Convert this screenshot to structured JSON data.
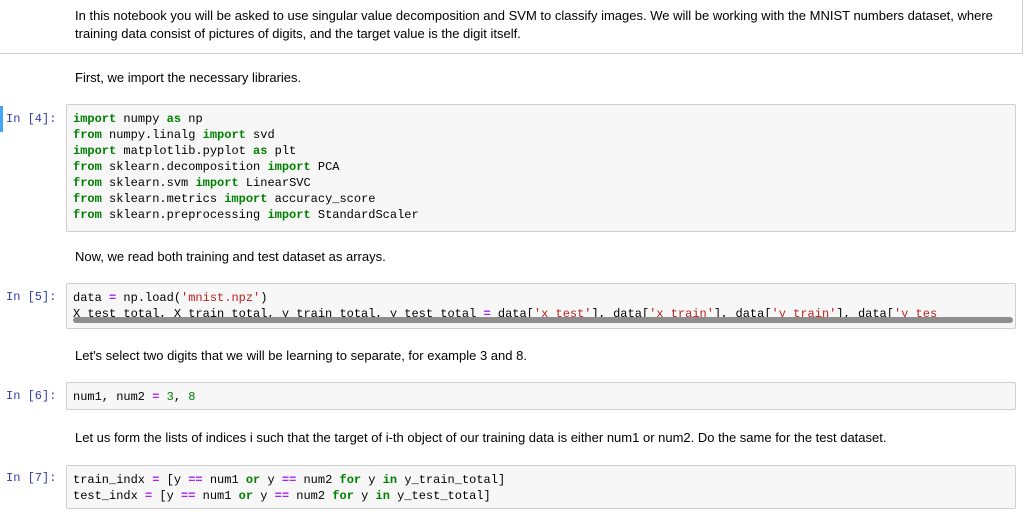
{
  "intro": "In this notebook you will be asked to use singular value decomposition and SVM to classify images. We will be working with the MNIST numbers dataset, where training data consist of pictures of digits, and the target value is the digit itself.",
  "md1": "First, we import the necessary libraries.",
  "md2": "Now, we read both training and test dataset as arrays.",
  "md3": "Let's select two digits that we will be learning to separate, for example 3 and 8.",
  "md4": "Let us form the lists of indices i such that the target of i-th object of our training data is either num1 or num2. Do the same for the test dataset.",
  "cells": [
    {
      "prompt": "In [4]:",
      "lines": [
        [
          [
            "kw",
            "import"
          ],
          [
            "t",
            " numpy "
          ],
          [
            "kw",
            "as"
          ],
          [
            "t",
            " np"
          ]
        ],
        [
          [
            "kw",
            "from"
          ],
          [
            "t",
            " numpy.linalg "
          ],
          [
            "kw",
            "import"
          ],
          [
            "t",
            " svd"
          ]
        ],
        [
          [
            "kw",
            "import"
          ],
          [
            "t",
            " matplotlib.pyplot "
          ],
          [
            "kw",
            "as"
          ],
          [
            "t",
            " plt"
          ]
        ],
        [
          [
            "kw",
            "from"
          ],
          [
            "t",
            " sklearn.decomposition "
          ],
          [
            "kw",
            "import"
          ],
          [
            "t",
            " PCA"
          ]
        ],
        [
          [
            "kw",
            "from"
          ],
          [
            "t",
            " sklearn.svm "
          ],
          [
            "kw",
            "import"
          ],
          [
            "t",
            " LinearSVC"
          ]
        ],
        [
          [
            "kw",
            "from"
          ],
          [
            "t",
            " sklearn.metrics "
          ],
          [
            "kw",
            "import"
          ],
          [
            "t",
            " accuracy_score"
          ]
        ],
        [
          [
            "kw",
            "from"
          ],
          [
            "t",
            " sklearn.preprocessing "
          ],
          [
            "kw",
            "import"
          ],
          [
            "t",
            " StandardScaler"
          ]
        ]
      ]
    },
    {
      "prompt": "In [5]:",
      "lines": [
        [
          [
            "t",
            "data "
          ],
          [
            "op",
            "="
          ],
          [
            "t",
            " np.load("
          ],
          [
            "str",
            "'mnist.npz'"
          ],
          [
            "t",
            ")"
          ]
        ],
        [
          [
            "t",
            "X_test_total, X_train_total, y_train_total, y_test_total "
          ],
          [
            "op",
            "="
          ],
          [
            "t",
            " data["
          ],
          [
            "str",
            "'x_test'"
          ],
          [
            "t",
            "], data["
          ],
          [
            "str",
            "'x_train'"
          ],
          [
            "t",
            "], data["
          ],
          [
            "str",
            "'y_train'"
          ],
          [
            "t",
            "], data["
          ],
          [
            "str",
            "'y_tes"
          ]
        ]
      ]
    },
    {
      "prompt": "In [6]:",
      "lines": [
        [
          [
            "t",
            "num1, num2 "
          ],
          [
            "op",
            "="
          ],
          [
            "t",
            " "
          ],
          [
            "num",
            "3"
          ],
          [
            "t",
            ", "
          ],
          [
            "num",
            "8"
          ]
        ]
      ]
    },
    {
      "prompt": "In [7]:",
      "lines": [
        [
          [
            "t",
            "train_indx "
          ],
          [
            "op",
            "="
          ],
          [
            "t",
            " [y "
          ],
          [
            "op",
            "=="
          ],
          [
            "t",
            " num1 "
          ],
          [
            "kw",
            "or"
          ],
          [
            "t",
            " y "
          ],
          [
            "op",
            "=="
          ],
          [
            "t",
            " num2 "
          ],
          [
            "kw",
            "for"
          ],
          [
            "t",
            " y "
          ],
          [
            "kw",
            "in"
          ],
          [
            "t",
            " y_train_total]"
          ]
        ],
        [
          [
            "t",
            "test_indx "
          ],
          [
            "op",
            "="
          ],
          [
            "t",
            " [y "
          ],
          [
            "op",
            "=="
          ],
          [
            "t",
            " num1 "
          ],
          [
            "kw",
            "or"
          ],
          [
            "t",
            " y "
          ],
          [
            "op",
            "=="
          ],
          [
            "t",
            " num2 "
          ],
          [
            "kw",
            "for"
          ],
          [
            "t",
            " y "
          ],
          [
            "kw",
            "in"
          ],
          [
            "t",
            " y_test_total]"
          ]
        ]
      ]
    }
  ]
}
